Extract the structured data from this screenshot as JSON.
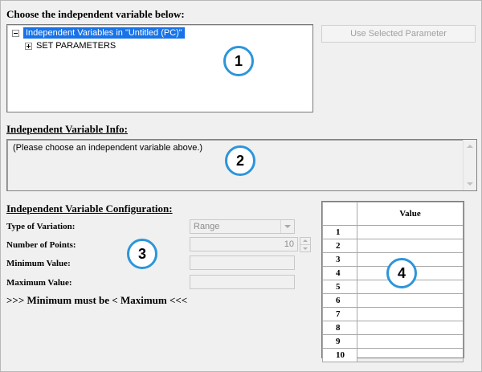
{
  "section1": {
    "title": "Choose the independent variable below:",
    "tree": {
      "root_label": "Independent Variables in \"Untitled (PC)\"",
      "child_label": "SET PARAMETERS"
    },
    "use_button": "Use Selected Parameter"
  },
  "section2": {
    "title": "Independent Variable Info:",
    "text": "(Please choose an independent variable above.)"
  },
  "section3": {
    "title": "Independent Variable Configuration:",
    "type_label": "Type of Variation:",
    "type_value": "Range",
    "points_label": "Number of Points:",
    "points_value": "10",
    "min_label": "Minimum Value:",
    "min_value": "",
    "max_label": "Maximum Value:",
    "max_value": "",
    "warning": ">>> Minimum must be < Maximum <<<"
  },
  "table": {
    "header": "Value",
    "rows": [
      "1",
      "2",
      "3",
      "4",
      "5",
      "6",
      "7",
      "8",
      "9",
      "10"
    ]
  },
  "callouts": [
    "1",
    "2",
    "3",
    "4"
  ],
  "colors": {
    "selection": "#1873e8",
    "callout_ring": "#2d95d9"
  }
}
